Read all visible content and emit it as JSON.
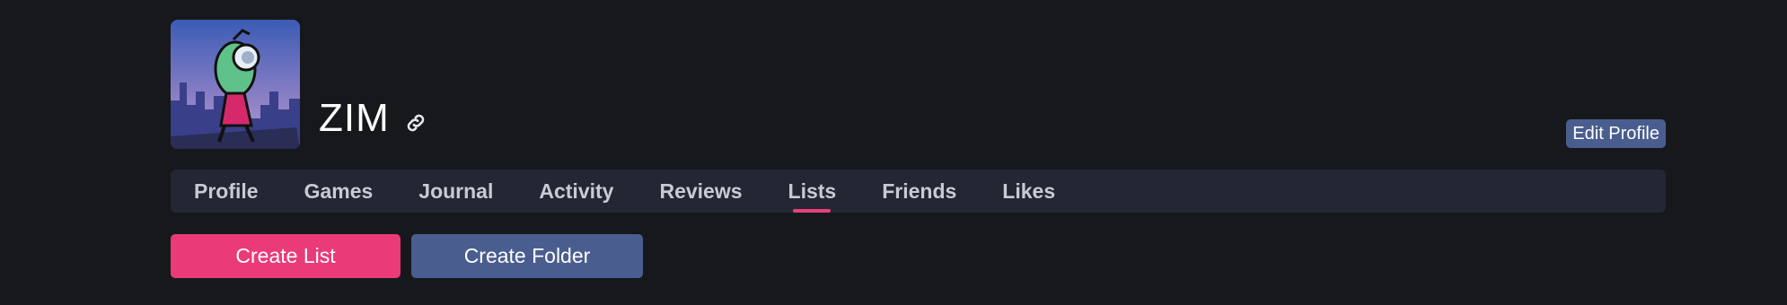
{
  "profile": {
    "username": "ZIM",
    "avatar_alt": "avatar",
    "link_icon": "link-icon",
    "edit_label": "Edit Profile"
  },
  "tabs": [
    {
      "label": "Profile",
      "active": false
    },
    {
      "label": "Games",
      "active": false
    },
    {
      "label": "Journal",
      "active": false
    },
    {
      "label": "Activity",
      "active": false
    },
    {
      "label": "Reviews",
      "active": false
    },
    {
      "label": "Lists",
      "active": true
    },
    {
      "label": "Friends",
      "active": false
    },
    {
      "label": "Likes",
      "active": false
    }
  ],
  "actions": {
    "create_list_label": "Create List",
    "create_folder_label": "Create Folder"
  },
  "colors": {
    "background": "#17181c",
    "tab_bar": "#232733",
    "accent_pink": "#ea3a78",
    "accent_blue": "#4a5d8f",
    "tab_text": "#c7cbd6"
  }
}
